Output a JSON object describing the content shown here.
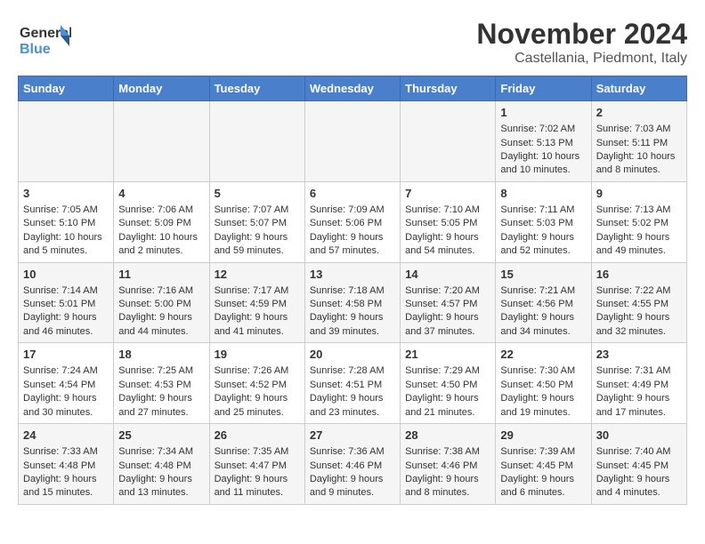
{
  "logo": {
    "line1": "General",
    "line2": "Blue"
  },
  "title": "November 2024",
  "location": "Castellania, Piedmont, Italy",
  "days_of_week": [
    "Sunday",
    "Monday",
    "Tuesday",
    "Wednesday",
    "Thursday",
    "Friday",
    "Saturday"
  ],
  "weeks": [
    [
      {
        "day": "",
        "info": ""
      },
      {
        "day": "",
        "info": ""
      },
      {
        "day": "",
        "info": ""
      },
      {
        "day": "",
        "info": ""
      },
      {
        "day": "",
        "info": ""
      },
      {
        "day": "1",
        "info": "Sunrise: 7:02 AM\nSunset: 5:13 PM\nDaylight: 10 hours and 10 minutes."
      },
      {
        "day": "2",
        "info": "Sunrise: 7:03 AM\nSunset: 5:11 PM\nDaylight: 10 hours and 8 minutes."
      }
    ],
    [
      {
        "day": "3",
        "info": "Sunrise: 7:05 AM\nSunset: 5:10 PM\nDaylight: 10 hours and 5 minutes."
      },
      {
        "day": "4",
        "info": "Sunrise: 7:06 AM\nSunset: 5:09 PM\nDaylight: 10 hours and 2 minutes."
      },
      {
        "day": "5",
        "info": "Sunrise: 7:07 AM\nSunset: 5:07 PM\nDaylight: 9 hours and 59 minutes."
      },
      {
        "day": "6",
        "info": "Sunrise: 7:09 AM\nSunset: 5:06 PM\nDaylight: 9 hours and 57 minutes."
      },
      {
        "day": "7",
        "info": "Sunrise: 7:10 AM\nSunset: 5:05 PM\nDaylight: 9 hours and 54 minutes."
      },
      {
        "day": "8",
        "info": "Sunrise: 7:11 AM\nSunset: 5:03 PM\nDaylight: 9 hours and 52 minutes."
      },
      {
        "day": "9",
        "info": "Sunrise: 7:13 AM\nSunset: 5:02 PM\nDaylight: 9 hours and 49 minutes."
      }
    ],
    [
      {
        "day": "10",
        "info": "Sunrise: 7:14 AM\nSunset: 5:01 PM\nDaylight: 9 hours and 46 minutes."
      },
      {
        "day": "11",
        "info": "Sunrise: 7:16 AM\nSunset: 5:00 PM\nDaylight: 9 hours and 44 minutes."
      },
      {
        "day": "12",
        "info": "Sunrise: 7:17 AM\nSunset: 4:59 PM\nDaylight: 9 hours and 41 minutes."
      },
      {
        "day": "13",
        "info": "Sunrise: 7:18 AM\nSunset: 4:58 PM\nDaylight: 9 hours and 39 minutes."
      },
      {
        "day": "14",
        "info": "Sunrise: 7:20 AM\nSunset: 4:57 PM\nDaylight: 9 hours and 37 minutes."
      },
      {
        "day": "15",
        "info": "Sunrise: 7:21 AM\nSunset: 4:56 PM\nDaylight: 9 hours and 34 minutes."
      },
      {
        "day": "16",
        "info": "Sunrise: 7:22 AM\nSunset: 4:55 PM\nDaylight: 9 hours and 32 minutes."
      }
    ],
    [
      {
        "day": "17",
        "info": "Sunrise: 7:24 AM\nSunset: 4:54 PM\nDaylight: 9 hours and 30 minutes."
      },
      {
        "day": "18",
        "info": "Sunrise: 7:25 AM\nSunset: 4:53 PM\nDaylight: 9 hours and 27 minutes."
      },
      {
        "day": "19",
        "info": "Sunrise: 7:26 AM\nSunset: 4:52 PM\nDaylight: 9 hours and 25 minutes."
      },
      {
        "day": "20",
        "info": "Sunrise: 7:28 AM\nSunset: 4:51 PM\nDaylight: 9 hours and 23 minutes."
      },
      {
        "day": "21",
        "info": "Sunrise: 7:29 AM\nSunset: 4:50 PM\nDaylight: 9 hours and 21 minutes."
      },
      {
        "day": "22",
        "info": "Sunrise: 7:30 AM\nSunset: 4:50 PM\nDaylight: 9 hours and 19 minutes."
      },
      {
        "day": "23",
        "info": "Sunrise: 7:31 AM\nSunset: 4:49 PM\nDaylight: 9 hours and 17 minutes."
      }
    ],
    [
      {
        "day": "24",
        "info": "Sunrise: 7:33 AM\nSunset: 4:48 PM\nDaylight: 9 hours and 15 minutes."
      },
      {
        "day": "25",
        "info": "Sunrise: 7:34 AM\nSunset: 4:48 PM\nDaylight: 9 hours and 13 minutes."
      },
      {
        "day": "26",
        "info": "Sunrise: 7:35 AM\nSunset: 4:47 PM\nDaylight: 9 hours and 11 minutes."
      },
      {
        "day": "27",
        "info": "Sunrise: 7:36 AM\nSunset: 4:46 PM\nDaylight: 9 hours and 9 minutes."
      },
      {
        "day": "28",
        "info": "Sunrise: 7:38 AM\nSunset: 4:46 PM\nDaylight: 9 hours and 8 minutes."
      },
      {
        "day": "29",
        "info": "Sunrise: 7:39 AM\nSunset: 4:45 PM\nDaylight: 9 hours and 6 minutes."
      },
      {
        "day": "30",
        "info": "Sunrise: 7:40 AM\nSunset: 4:45 PM\nDaylight: 9 hours and 4 minutes."
      }
    ]
  ]
}
